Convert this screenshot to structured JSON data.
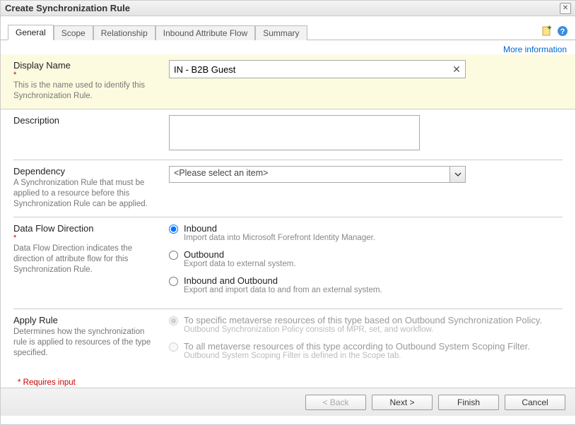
{
  "window": {
    "title": "Create Synchronization Rule"
  },
  "tabs": {
    "items": [
      "General",
      "Scope",
      "Relationship",
      "Inbound Attribute Flow",
      "Summary"
    ],
    "active": 0
  },
  "links": {
    "more_info": "More information"
  },
  "form": {
    "display_name": {
      "label": "Display Name",
      "help": "This is the name used to identify this Synchronization Rule.",
      "value": "IN - B2B Guest",
      "required": "*"
    },
    "description": {
      "label": "Description",
      "value": ""
    },
    "dependency": {
      "label": "Dependency",
      "help": "A Synchronization Rule that must be applied to a resource before this Synchronization Rule can be applied.",
      "placeholder": "<Please select an item>"
    },
    "flow": {
      "label": "Data Flow Direction",
      "help": "Data Flow Direction indicates the direction of attribute flow for this Synchronization Rule.",
      "required": "*",
      "options": [
        {
          "label": "Inbound",
          "sub": "Import data into Microsoft Forefront Identity Manager.",
          "checked": true
        },
        {
          "label": "Outbound",
          "sub": "Export data to external system.",
          "checked": false
        },
        {
          "label": "Inbound and Outbound",
          "sub": "Export and import data to and from an external system.",
          "checked": false
        }
      ]
    },
    "apply_rule": {
      "label": "Apply Rule",
      "help": "Determines how the synchronization rule is applied to resources of the type specified.",
      "options": [
        {
          "label": "To specific metaverse resources of this type based on Outbound Synchronization Policy.",
          "sub": "Outbound Synchronization Policy consists of MPR, set, and workflow.",
          "checked": true
        },
        {
          "label": "To all metaverse resources of this type according to Outbound System Scoping Filter.",
          "sub": "Outbound System Scoping Filter is defined in the Scope tab.",
          "checked": false
        }
      ]
    },
    "requires_note": "* Requires input"
  },
  "buttons": {
    "back": "< Back",
    "next": "Next >",
    "finish": "Finish",
    "cancel": "Cancel"
  }
}
